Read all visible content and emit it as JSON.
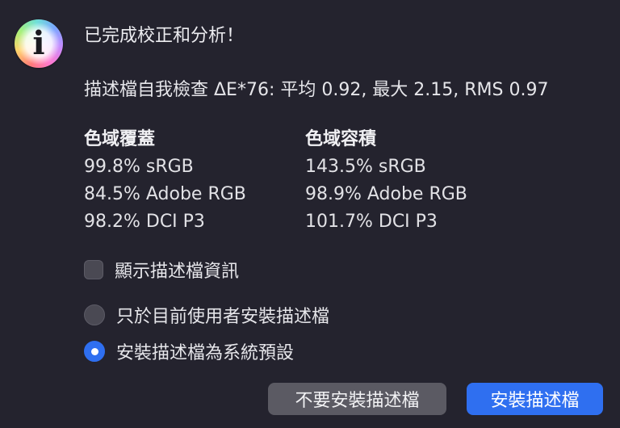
{
  "dialog": {
    "title": "已完成校正和分析！",
    "check_result": "描述檔自我檢查 ΔE*76: 平均 0.92, 最大 2.15, RMS 0.97",
    "coverage": {
      "heading": "色域覆蓋",
      "values": [
        "99.8% sRGB",
        "84.5% Adobe RGB",
        "98.2% DCI P3"
      ]
    },
    "volume": {
      "heading": "色域容積",
      "values": [
        "143.5% sRGB",
        "98.9% Adobe RGB",
        "101.7% DCI P3"
      ]
    },
    "show_profile_info": {
      "label": "顯示描述檔資訊",
      "checked": false
    },
    "install_options": [
      {
        "label": "只於目前使用者安裝描述檔",
        "selected": false
      },
      {
        "label": "安裝描述檔為系統預設",
        "selected": true
      }
    ],
    "buttons": {
      "dont_install": "不要安裝描述檔",
      "install": "安裝描述檔"
    },
    "icon": "info-icon",
    "colors": {
      "background": "#24232e",
      "accent": "#2f6ff0",
      "secondary_button": "#5b5a63"
    }
  }
}
